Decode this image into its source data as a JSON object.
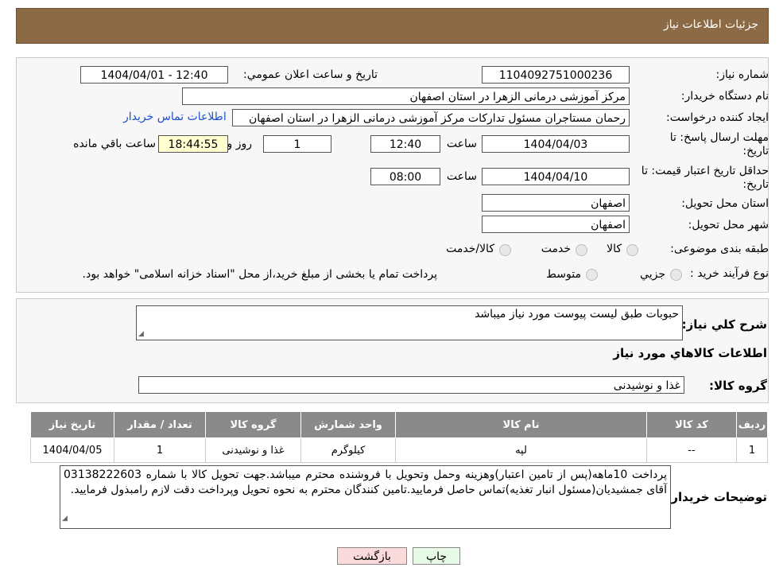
{
  "header": {
    "title": "جزئیات اطلاعات نیاز"
  },
  "form": {
    "need_number_label": "شماره نیاز:",
    "need_number": "1104092751000236",
    "announce_label": "تاریخ و ساعت اعلان عمومي:",
    "announce_value": "1404/04/01 - 12:40",
    "buyer_org_label": "نام دستگاه خریدار:",
    "buyer_org": "مرکز آموزشی درمانی الزهرا در استان اصفهان",
    "creator_label": "ایجاد کننده درخواست:",
    "creator": "رحمان مستاجران مسئول تدارکات مرکز آموزشی درمانی الزهرا در استان اصفهان",
    "contact_link": "اطلاعات تماس خریدار",
    "deadline_label_1": "مهلت ارسال پاسخ: تا",
    "deadline_label_2": "تاریخ:",
    "deadline_date": "1404/04/03",
    "time_label": "ساعت",
    "deadline_time": "12:40",
    "days_value": "1",
    "days_label": "روز و",
    "remaining_time": "18:44:55",
    "remaining_label": "ساعت باقي مانده",
    "validity_label_1": "حداقل تاریخ اعتبار قیمت: تا",
    "validity_label_2": "تاریخ:",
    "validity_date": "1404/04/10",
    "validity_time": "08:00",
    "province_label": "استان محل تحویل:",
    "province": "اصفهان",
    "city_label": "شهر محل تحویل:",
    "city": "اصفهان",
    "category_label": "طبقه بندی موضوعی:",
    "category_options": [
      "کالا",
      "خدمت",
      "کالا/خدمت"
    ],
    "process_label": "نوع فرآیند خرید :",
    "process_options": [
      "جزیي",
      "متوسط"
    ],
    "process_note": "پرداخت تمام یا بخشی از مبلغ خرید،از محل \"اسناد خزانه اسلامی\" خواهد بود."
  },
  "summary": {
    "desc_label": "شرح كلي نیاز:",
    "desc_value": "حبوبات طبق لیست پیوست مورد نیاز میباشد",
    "goods_info_title": "اطلاعات کالاهاي مورد نیاز",
    "group_label": "گروه کالا:",
    "group_value": "غذا و نوشیدنی"
  },
  "table": {
    "headers": [
      "ردیف",
      "کد کالا",
      "نام کالا",
      "واحد شمارش",
      "گروه کالا",
      "تعداد / مقدار",
      "تاریخ نیاز"
    ],
    "rows": [
      [
        "1",
        "--",
        "لپه",
        "کیلوگرم",
        "غذا و نوشیدنی",
        "1",
        "1404/04/05"
      ]
    ]
  },
  "buyer_notes": {
    "label": "توضیحات خریدار:",
    "text": "پرداخت 10ماهه(پس از تامین اعتبار)وهزینه وحمل وتحویل با فروشنده محترم میباشد.جهت تحویل کالا با شماره 03138222603 آقای جمشیدیان(مسئول انبار تغذیه)تماس حاصل فرمایید.تامین کنندگان محترم به نحوه تحویل وپرداخت دقت لازم رامبذول فرمایید."
  },
  "buttons": {
    "print": "چاپ",
    "back": "بازگشت"
  }
}
